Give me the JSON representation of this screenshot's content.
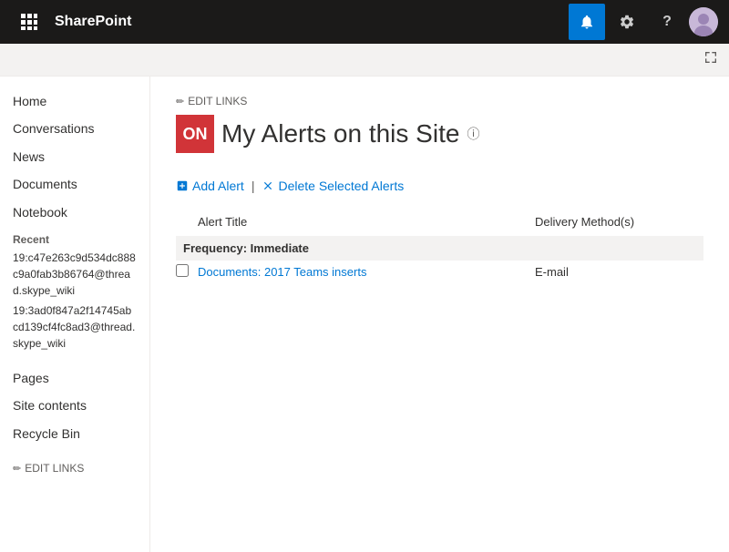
{
  "app": {
    "brand": "SharePoint"
  },
  "topnav": {
    "waffle_icon": "⊞",
    "bell_icon": "🔔",
    "gear_icon": "⚙",
    "help_icon": "?",
    "expand_icon": "⤢"
  },
  "site": {
    "logo_text": "ON",
    "edit_links_label": "EDIT LINKS",
    "page_title": "My Alerts on this Site",
    "info_icon": "ⓘ"
  },
  "sidebar": {
    "logo_text": "ON",
    "items": [
      {
        "label": "Home",
        "name": "sidebar-item-home"
      },
      {
        "label": "Conversations",
        "name": "sidebar-item-conversations"
      },
      {
        "label": "News",
        "name": "sidebar-item-news"
      },
      {
        "label": "Documents",
        "name": "sidebar-item-documents"
      },
      {
        "label": "Notebook",
        "name": "sidebar-item-notebook"
      }
    ],
    "recent_label": "Recent",
    "recent_items": [
      "19:c47e263c9d534dc888c9a0fab3b86764@thread.skype_wiki",
      "19:3ad0f847a2f14745abcd139cf4fc8ad3@thread.skype_wiki"
    ],
    "pages_label": "Pages",
    "site_contents_label": "Site contents",
    "recycle_bin_label": "Recycle Bin",
    "edit_links_label": "EDIT LINKS"
  },
  "toolbar": {
    "add_alert_label": "Add Alert",
    "separator": "|",
    "delete_alerts_label": "Delete Selected Alerts"
  },
  "table": {
    "col_title": "Alert Title",
    "frequency_label": "Frequency: Immediate",
    "col_delivery": "Delivery Method(s)",
    "rows": [
      {
        "title": "Documents: 2017 Teams inserts",
        "delivery": "E-mail"
      }
    ]
  }
}
